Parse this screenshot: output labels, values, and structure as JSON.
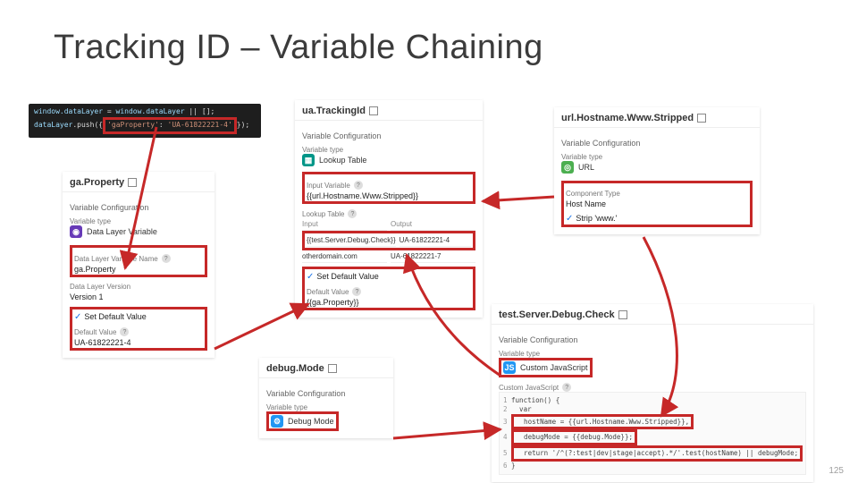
{
  "slide": {
    "title": "Tracking ID – Variable Chaining",
    "page_num": "125"
  },
  "code": {
    "line1a": "window.",
    "line1b": "dataLayer",
    "line1c": " = ",
    "line1d": "window.",
    "line1e": "dataLayer",
    "line1f": " || [];",
    "line2a": "dataLayer",
    "line2b": ".push({",
    "line2c": "'gaProperty'",
    "line2d": ": ",
    "line2e": "'UA-61822221-4'",
    "line2f": "});"
  },
  "gaProperty": {
    "title": "ga.Property",
    "section": "Variable Configuration",
    "type_label": "Variable type",
    "type": "Data Layer Variable",
    "name_label": "Data Layer Variable Name",
    "name": "ga.Property",
    "ver_label": "Data Layer Version",
    "ver": "Version 1",
    "setdef": "Set Default Value",
    "def_label": "Default Value",
    "def": "UA-61822221-4"
  },
  "uaTracking": {
    "title": "ua.TrackingId",
    "section": "Variable Configuration",
    "type_label": "Variable type",
    "type": "Lookup Table",
    "input_label": "Input Variable",
    "input": "{{url.Hostname.Www.Stripped}}",
    "table_label": "Lookup Table",
    "col_in": "Input",
    "col_out": "Output",
    "row1_in": "{{test.Server.Debug.Check}}",
    "row1_out": "UA-61822221-4",
    "row2_in": "otherdomain.com",
    "row2_out": "UA-61822221-7",
    "setdef": "Set Default Value",
    "def_label": "Default Value",
    "def": "{{ga.Property}}"
  },
  "urlHost": {
    "title": "url.Hostname.Www.Stripped",
    "section": "Variable Configuration",
    "type_label": "Variable type",
    "type": "URL",
    "comp_label": "Component Type",
    "comp": "Host Name",
    "strip": "Strip 'www.'"
  },
  "testServer": {
    "title": "test.Server.Debug.Check",
    "section": "Variable Configuration",
    "type_label": "Variable type",
    "type": "Custom JavaScript",
    "code_label": "Custom JavaScript",
    "l1": "function() {",
    "l2": "  var",
    "l3": "  hostName = {{url.Hostname.Www.Stripped}},",
    "l4": "  debugMode = {{debug.Mode}};",
    "l5": "  return '/^(?:test|dev|stage|accept).*/'.test(hostName) || debugMode;",
    "l6": "}"
  },
  "debugMode": {
    "title": "debug.Mode",
    "section": "Variable Configuration",
    "type_label": "Variable type",
    "type": "Debug Mode"
  }
}
